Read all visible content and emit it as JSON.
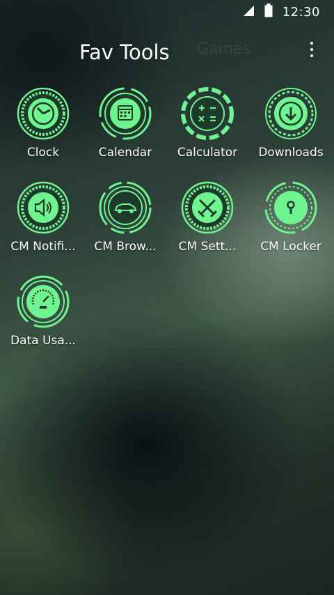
{
  "status_bar": {
    "time": "12:30",
    "icons": [
      "signal-icon",
      "battery-icon"
    ]
  },
  "header": {
    "tabs": [
      {
        "label": "Fav Tools",
        "active": true
      },
      {
        "label": "Games",
        "active": false
      }
    ],
    "menu_icon": "more-vert-icon"
  },
  "apps": [
    {
      "label": "Clock",
      "icon": "clock-icon"
    },
    {
      "label": "Calendar",
      "icon": "calendar-icon"
    },
    {
      "label": "Calculator",
      "icon": "calculator-icon"
    },
    {
      "label": "Downloads",
      "icon": "download-icon"
    },
    {
      "label": "CM Notifi...",
      "icon": "speaker-icon"
    },
    {
      "label": "CM Brow...",
      "icon": "car-icon"
    },
    {
      "label": "CM Sett...",
      "icon": "swords-icon"
    },
    {
      "label": "CM Locker",
      "icon": "lock-icon"
    },
    {
      "label": "Data Usa...",
      "icon": "speedometer-icon"
    }
  ],
  "colors": {
    "accent": "#6ff58f",
    "accent_dark": "#1e3a2a",
    "text": "#ffffff"
  }
}
